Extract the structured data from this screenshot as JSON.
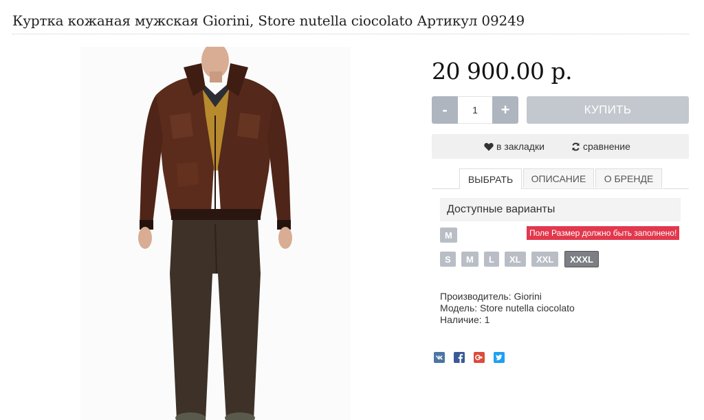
{
  "product": {
    "title": "Куртка кожаная мужская Giorini, Store nutella ciocolato Артикул 09249",
    "price": "20 900.00 р."
  },
  "cart": {
    "minus_label": "-",
    "plus_label": "+",
    "quantity": "1",
    "buy_label": "КУПИТЬ"
  },
  "actions": {
    "bookmark_label": "в закладки",
    "compare_label": "сравнение"
  },
  "tabs": [
    {
      "label": "ВЫБРАТЬ",
      "active": true
    },
    {
      "label": "ОПИСАНИЕ",
      "active": false
    },
    {
      "label": "О БРЕНДЕ",
      "active": false
    }
  ],
  "variants": {
    "heading": "Доступные варианты",
    "group1": [
      "M"
    ],
    "sizes": [
      "S",
      "M",
      "L",
      "XL",
      "XXL",
      "XXXL"
    ],
    "selected_size": "XXXL",
    "error": "Поле Размер должно быть заполнено!"
  },
  "details": {
    "manufacturer": "Производитель: Giorini",
    "model": "Модель: Store nutella ciocolato",
    "stock": "Наличие: 1"
  },
  "social": [
    {
      "icon": "vk-icon",
      "color": "#4c75a3",
      "glyph": "vk"
    },
    {
      "icon": "facebook-icon",
      "color": "#3b5998",
      "glyph": "f"
    },
    {
      "icon": "google-plus-icon",
      "color": "#dd4b39",
      "glyph": "g+"
    },
    {
      "icon": "twitter-icon",
      "color": "#1da1f2",
      "glyph": "t"
    }
  ],
  "colors": {
    "button_gray": "#aeb5bf",
    "buy_button": "#c3c8ce",
    "error": "#e2384d",
    "selected_chip": "#7c7f84"
  }
}
